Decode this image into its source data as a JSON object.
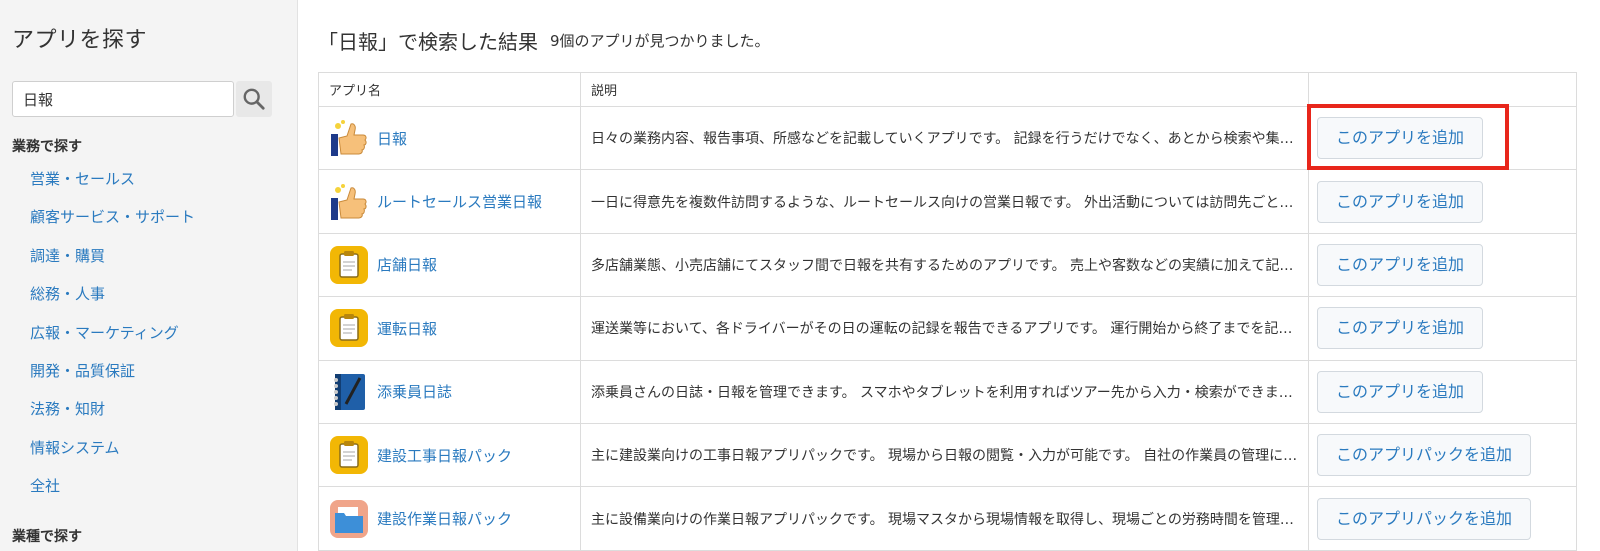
{
  "sidebar": {
    "title": "アプリを探す",
    "search_value": "日報",
    "section1": "業務で探す",
    "categories": [
      "営業・セールス",
      "顧客サービス・サポート",
      "調達・購買",
      "総務・人事",
      "広報・マーケティング",
      "開発・品質保証",
      "法務・知財",
      "情報システム",
      "全社"
    ],
    "section2": "業種で探す"
  },
  "main": {
    "title": "「日報」で検索した結果",
    "count": "9個のアプリが見つかりました。",
    "columns": {
      "name": "アプリ名",
      "desc": "説明",
      "action": ""
    },
    "rows": [
      {
        "icon": "thumbs-up-icon",
        "name": "日報",
        "desc": "日々の業務内容、報告事項、所感などを記載していくアプリです。 記録を行うだけでなく、あとから検索や集計ができます。",
        "button": "このアプリを追加"
      },
      {
        "icon": "thumbs-up-icon",
        "name": "ルートセールス営業日報",
        "desc": "一日に得意先を複数件訪問するような、ルートセールス向けの営業日報です。 外出活動については訪問先ごとに記録できます。",
        "button": "このアプリを追加"
      },
      {
        "icon": "clipboard-icon",
        "name": "店舗日報",
        "desc": "多店舗業態、小売店舗にてスタッフ間で日報を共有するためのアプリです。 売上や客数などの実績に加えて記録できます。",
        "button": "このアプリを追加"
      },
      {
        "icon": "clipboard-icon",
        "name": "運転日報",
        "desc": "運送業等において、各ドライバーがその日の運転の記録を報告できるアプリです。 運行開始から終了までを記録します。",
        "button": "このアプリを追加"
      },
      {
        "icon": "notebook-icon",
        "name": "添乗員日誌",
        "desc": "添乗員さんの日誌・日報を管理できます。 スマホやタブレットを利用すればツアー先から入力・検索ができます。",
        "button": "このアプリを追加"
      },
      {
        "icon": "clipboard-icon",
        "name": "建設工事日報パック",
        "desc": "主に建設業向けの工事日報アプリパックです。 現場から日報の閲覧・入力が可能です。 自社の作業員の管理にも。",
        "button": "このアプリパックを追加"
      },
      {
        "icon": "folder-icon",
        "name": "建設作業日報パック",
        "desc": "主に設備業向けの作業日報アプリパックです。 現場マスタから現場情報を取得し、現場ごとの労務時間を管理します。",
        "button": "このアプリパックを追加"
      }
    ]
  },
  "colors": {
    "link": "#2a7abf",
    "highlight": "#e8261b",
    "sidebar_bg": "#f4f4f4"
  }
}
